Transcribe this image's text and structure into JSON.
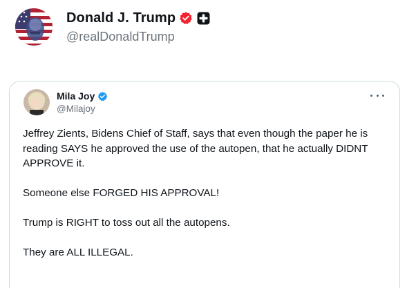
{
  "post": {
    "author_name": "Donald J. Trump",
    "author_handle": "@realDonaldTrump",
    "avatar_icon": "flag-portrait-avatar",
    "verified_badge_color": "#f4212e",
    "affiliate_badge_icon": "affiliate-badge-icon"
  },
  "quote": {
    "author_name": "Mila Joy",
    "author_handle": "@Milajoy",
    "verified_badge_color": "#1d9bf0",
    "more_icon": "more-icon",
    "paragraphs": [
      "Jeffrey Zients, Bidens Chief of Staff, says that even though the paper he is reading SAYS he approved the use of the autopen, that he actually DIDNT APPROVE it.",
      "Someone else FORGED HIS APPROVAL!",
      "Trump is RIGHT to toss out all the autopens.",
      "They are ALL ILLEGAL."
    ]
  }
}
